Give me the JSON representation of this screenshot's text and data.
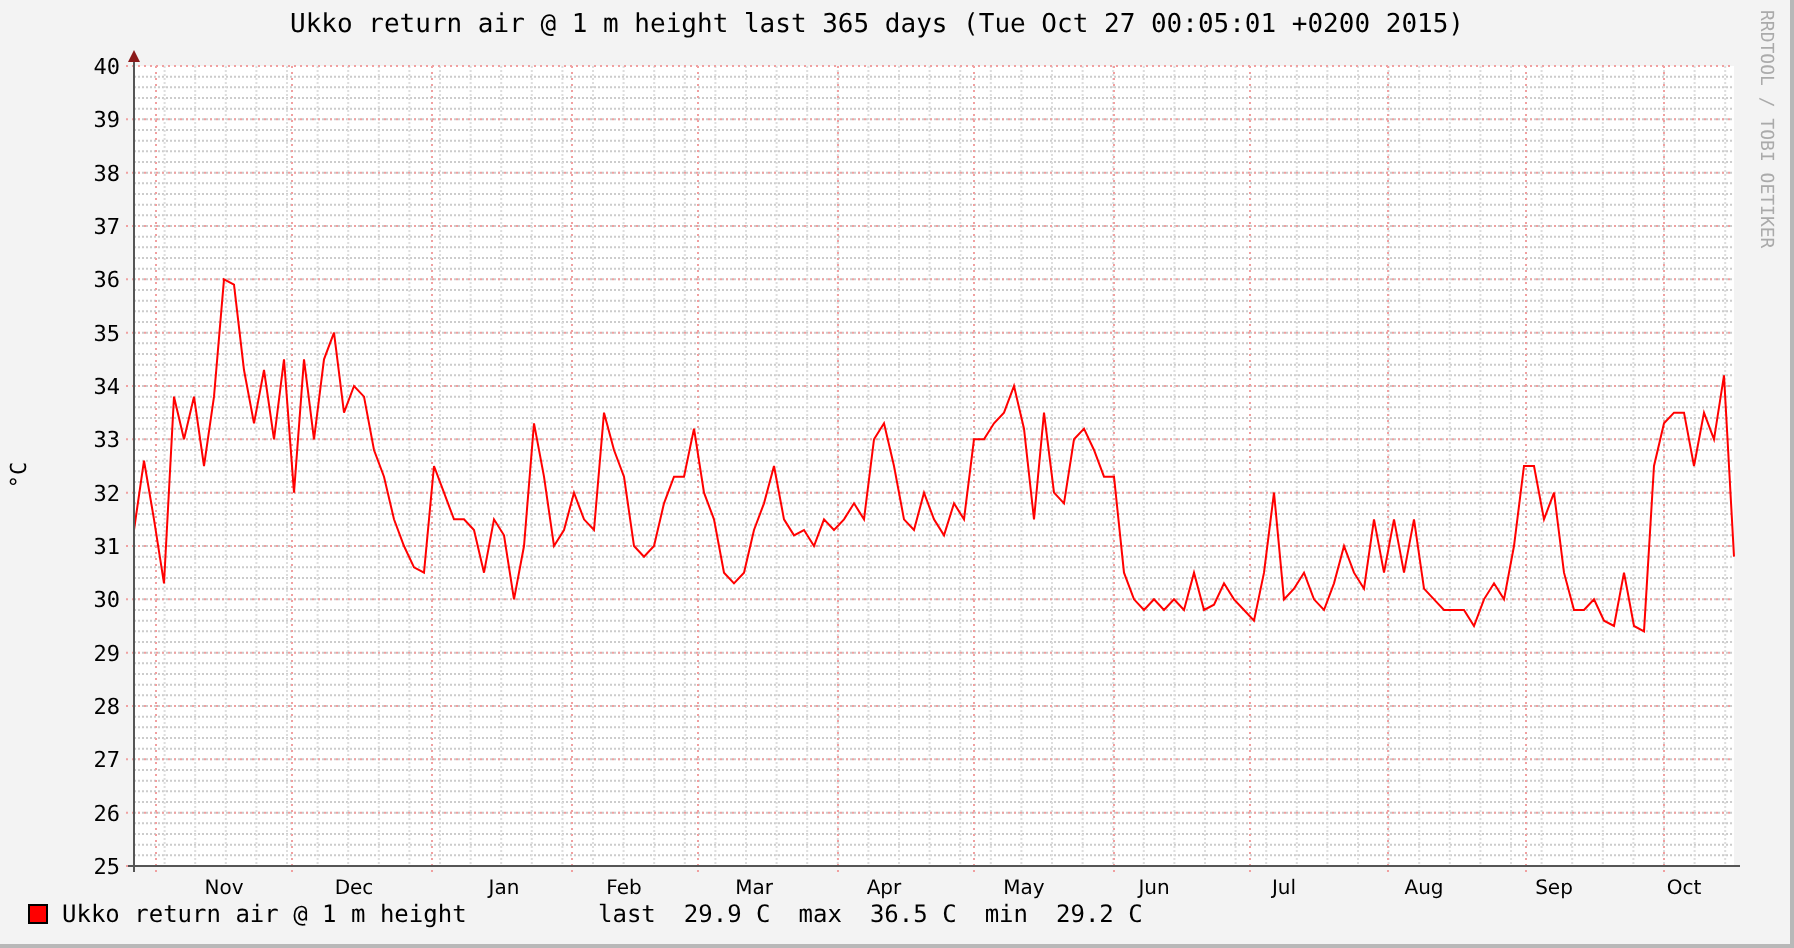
{
  "title": "Ukko return air @ 1 m height last 365 days (Tue Oct 27 00:05:01 +0200 2015)",
  "side_text": "RRDTOOL / TOBI OETIKER",
  "chart_data": {
    "type": "line",
    "ylabel": "°C",
    "ylim": [
      25,
      40
    ],
    "grid": true,
    "yticks": [
      25,
      26,
      27,
      28,
      29,
      30,
      31,
      32,
      33,
      34,
      35,
      36,
      37,
      38,
      39,
      40
    ],
    "categories": [
      null,
      null,
      null,
      null,
      null,
      null,
      null,
      null,
      null,
      "Nov",
      null,
      null,
      null,
      null,
      null,
      null,
      null,
      null,
      null,
      null,
      null,
      null,
      "Dec",
      null,
      null,
      null,
      null,
      null,
      null,
      null,
      null,
      null,
      null,
      null,
      null,
      null,
      null,
      "Jan",
      null,
      null,
      null,
      null,
      null,
      null,
      null,
      null,
      null,
      null,
      null,
      "Feb",
      null,
      null,
      null,
      null,
      null,
      null,
      null,
      null,
      null,
      null,
      null,
      null,
      "Mar",
      null,
      null,
      null,
      null,
      null,
      null,
      null,
      null,
      null,
      null,
      null,
      null,
      "Apr",
      null,
      null,
      null,
      null,
      null,
      null,
      null,
      null,
      null,
      null,
      null,
      null,
      null,
      "May",
      null,
      null,
      null,
      null,
      null,
      null,
      null,
      null,
      null,
      null,
      null,
      null,
      "Jun",
      null,
      null,
      null,
      null,
      null,
      null,
      null,
      null,
      null,
      null,
      null,
      null,
      "Jul",
      null,
      null,
      null,
      null,
      null,
      null,
      null,
      null,
      null,
      null,
      null,
      null,
      null,
      "Aug",
      null,
      null,
      null,
      null,
      null,
      null,
      null,
      null,
      null,
      null,
      null,
      null,
      "Sep",
      null,
      null,
      null,
      null,
      null,
      null,
      null,
      null,
      null,
      null,
      null,
      null,
      "Oct",
      null,
      null,
      null,
      null,
      null
    ],
    "series": [
      {
        "name": "Ukko return air @ 1 m height",
        "color": "#ff0000",
        "values": [
          31.3,
          32.6,
          31.5,
          30.3,
          33.8,
          33.0,
          33.8,
          32.5,
          33.8,
          36.0,
          35.9,
          34.3,
          33.3,
          34.3,
          33.0,
          34.5,
          32.0,
          34.5,
          33.0,
          34.5,
          35.0,
          33.5,
          34.0,
          33.8,
          32.8,
          32.3,
          31.5,
          31.0,
          30.6,
          30.5,
          32.5,
          32.0,
          31.5,
          31.5,
          31.3,
          30.5,
          31.5,
          31.2,
          30.0,
          31.0,
          33.3,
          32.3,
          31.0,
          31.3,
          32.0,
          31.5,
          31.3,
          33.5,
          32.8,
          32.3,
          31.0,
          30.8,
          31.0,
          31.8,
          32.3,
          32.3,
          33.2,
          32.0,
          31.5,
          30.5,
          30.3,
          30.5,
          31.3,
          31.8,
          32.5,
          31.5,
          31.2,
          31.3,
          31.0,
          31.5,
          31.3,
          31.5,
          31.8,
          31.5,
          33.0,
          33.3,
          32.5,
          31.5,
          31.3,
          32.0,
          31.5,
          31.2,
          31.8,
          31.5,
          33.0,
          33.0,
          33.3,
          33.5,
          34.0,
          33.2,
          31.5,
          33.5,
          32.0,
          31.8,
          33.0,
          33.2,
          32.8,
          32.3,
          32.3,
          30.5,
          30.0,
          29.8,
          30.0,
          29.8,
          30.0,
          29.8,
          30.5,
          29.8,
          29.9,
          30.3,
          30.0,
          29.8,
          29.6,
          30.5,
          32.0,
          30.0,
          30.2,
          30.5,
          30.0,
          29.8,
          30.3,
          31.0,
          30.5,
          30.2,
          31.5,
          30.5,
          31.5,
          30.5,
          31.5,
          30.2,
          30.0,
          29.8,
          29.8,
          29.8,
          29.5,
          30.0,
          30.3,
          30.0,
          31.0,
          32.5,
          32.5,
          31.5,
          32.0,
          30.5,
          29.8,
          29.8,
          30.0,
          29.6,
          29.5,
          30.5,
          29.5,
          29.4,
          32.5,
          33.3,
          33.5,
          33.5,
          32.5,
          33.5,
          33.0,
          34.2,
          30.8
        ]
      }
    ]
  },
  "legend": {
    "stats": [
      {
        "label": "last",
        "value": "29.9 C"
      },
      {
        "label": "max",
        "value": "36.5 C"
      },
      {
        "label": "min",
        "value": "29.2 C"
      }
    ]
  }
}
